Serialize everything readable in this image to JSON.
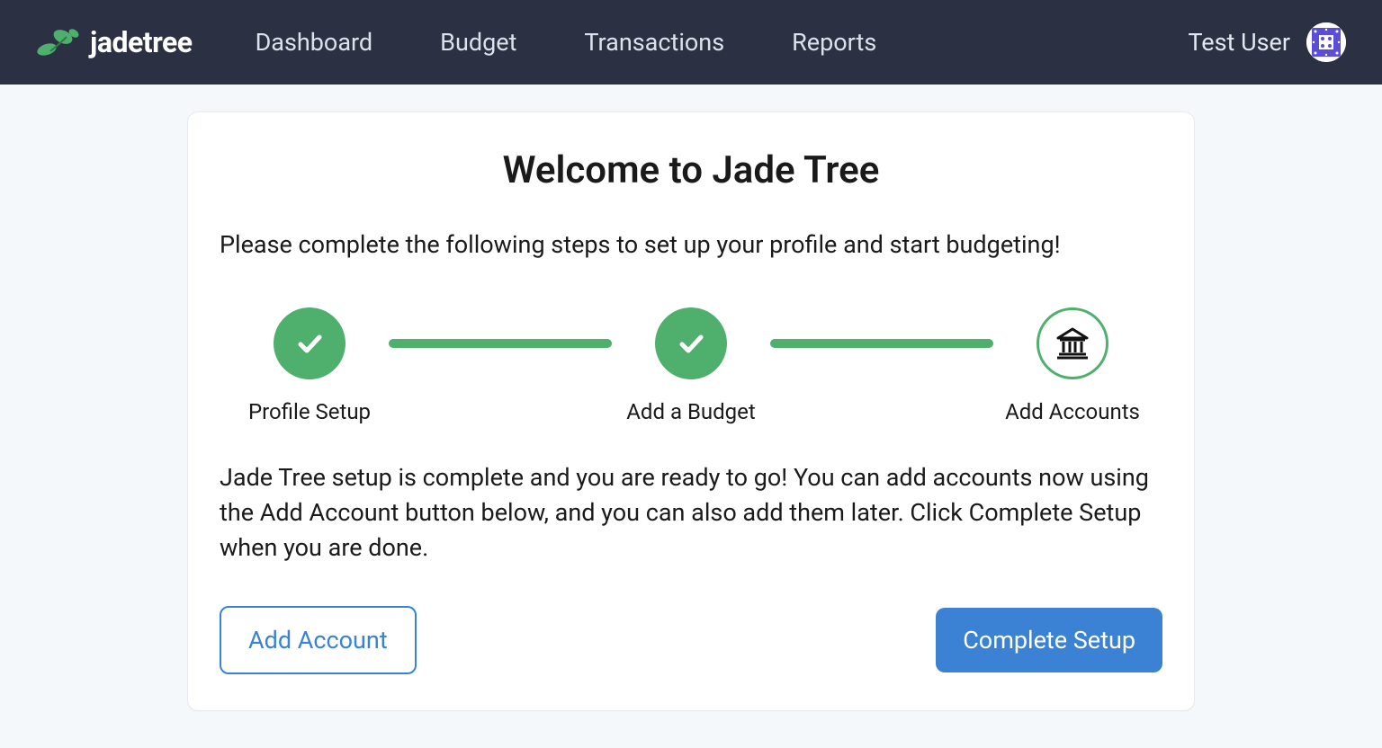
{
  "header": {
    "logo_text": "jadetree",
    "nav": [
      {
        "label": "Dashboard"
      },
      {
        "label": "Budget"
      },
      {
        "label": "Transactions"
      },
      {
        "label": "Reports"
      }
    ],
    "user_name": "Test User"
  },
  "card": {
    "title": "Welcome to Jade Tree",
    "intro": "Please complete the following steps to set up your profile and start budgeting!",
    "steps": [
      {
        "label": "Profile Setup",
        "state": "done"
      },
      {
        "label": "Add a Budget",
        "state": "done"
      },
      {
        "label": "Add Accounts",
        "state": "current"
      }
    ],
    "body": "Jade Tree setup is complete and you are ready to go! You can add accounts now using the Add Account button below, and you can also add them later. Click Complete Setup when you are done.",
    "add_account_label": "Add Account",
    "complete_setup_label": "Complete Setup"
  },
  "colors": {
    "header_bg": "#2b3142",
    "accent_green": "#4fb06d",
    "accent_blue": "#3b82d4",
    "page_bg": "#f5f8fb"
  }
}
